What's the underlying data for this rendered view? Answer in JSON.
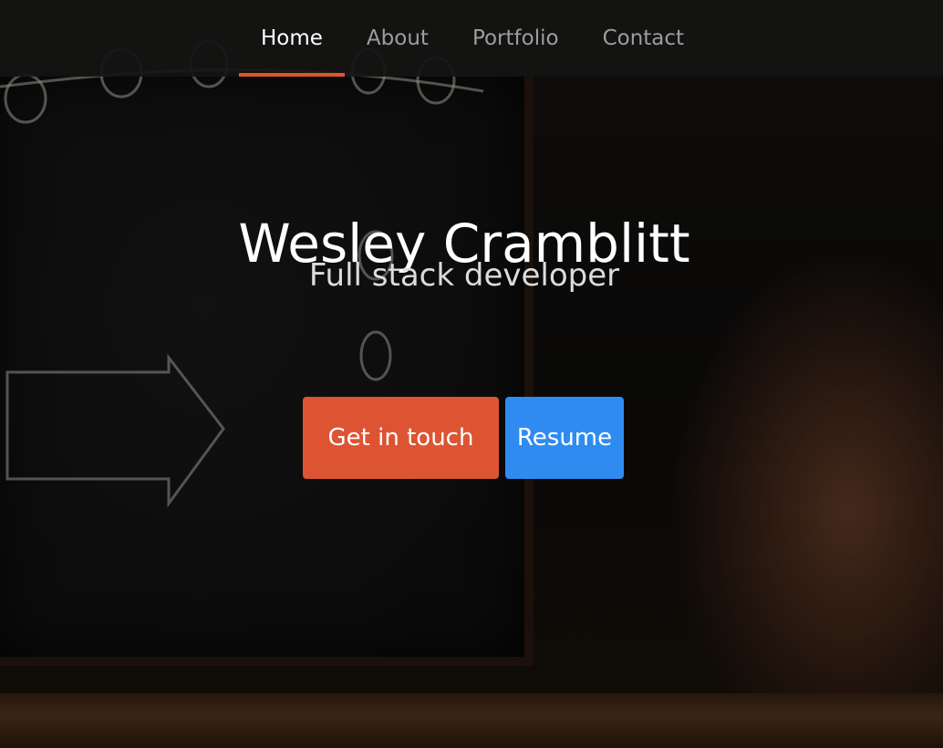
{
  "nav": {
    "items": [
      {
        "label": "Home",
        "active": true
      },
      {
        "label": "About",
        "active": false
      },
      {
        "label": "Portfolio",
        "active": false
      },
      {
        "label": "Contact",
        "active": false
      }
    ],
    "active_color": "#e0542c"
  },
  "hero": {
    "title": "Wesley Cramblitt",
    "subtitle": "Full stack developer",
    "buttons": {
      "contact_label": "Get in touch",
      "resume_label": "Resume"
    }
  },
  "colors": {
    "primary_button": "#dd5433",
    "secondary_button": "#2f8bf0"
  }
}
